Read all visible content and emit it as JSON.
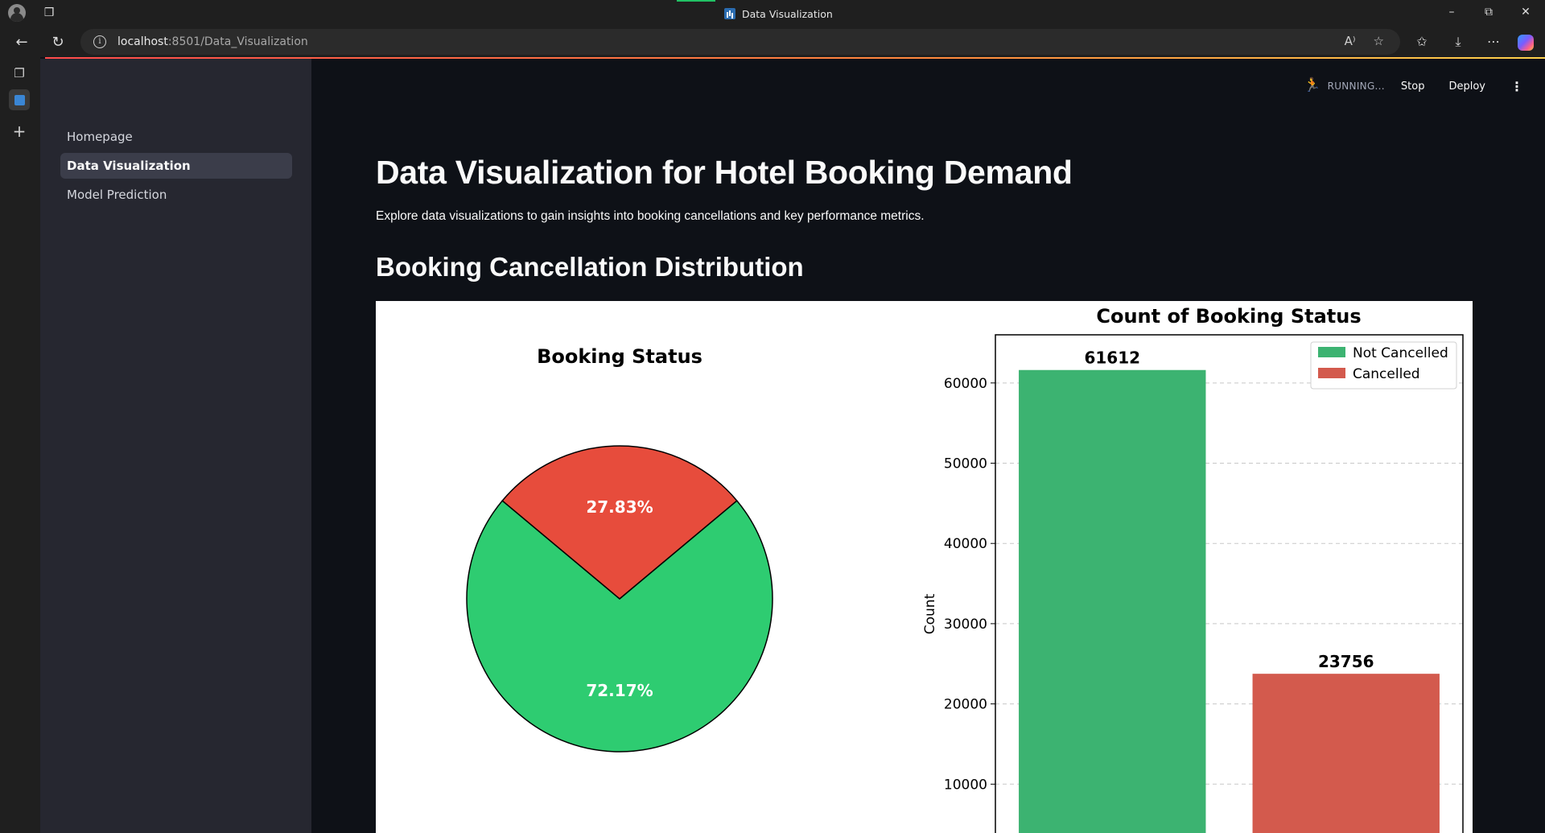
{
  "browser": {
    "tab_title": "Data Visualization",
    "url_host": "localhost",
    "url_rest": ":8501/Data_Visualization",
    "minimize": "–",
    "restore": "⧉",
    "close": "✕"
  },
  "sidebar": {
    "items": [
      {
        "label": "Homepage",
        "active": false
      },
      {
        "label": "Data Visualization",
        "active": true
      },
      {
        "label": "Model Prediction",
        "active": false
      }
    ]
  },
  "header": {
    "status": "RUNNING...",
    "stop_label": "Stop",
    "deploy_label": "Deploy",
    "menu_icon": "⋮"
  },
  "main": {
    "title": "Data Visualization for Hotel Booking Demand",
    "subtitle": "Explore data visualizations to gain insights into booking cancellations and key performance metrics.",
    "section_title": "Booking Cancellation Distribution"
  },
  "colors": {
    "not_cancelled": "#2ecc71",
    "cancelled": "#e74c3c",
    "bar_not_cancelled": "#3cb371",
    "bar_cancelled": "#d35a4d"
  },
  "chart_data": [
    {
      "type": "pie",
      "title": "Booking Status",
      "labels": [
        "Not Cancelled",
        "Cancelled"
      ],
      "values": [
        72.17,
        27.83
      ],
      "value_labels": [
        "72.17%",
        "27.83%"
      ]
    },
    {
      "type": "bar",
      "title": "Count of Booking Status",
      "categories": [
        "Not Cancelled",
        "Cancelled"
      ],
      "values": [
        61612,
        23756
      ],
      "value_labels": [
        "61612",
        "23756"
      ],
      "ylabel": "Count",
      "xlabel": "",
      "yticks": [
        "10000",
        "20000",
        "30000",
        "40000",
        "50000",
        "60000"
      ],
      "ylim": [
        0,
        66000
      ],
      "legend": [
        "Not Cancelled",
        "Cancelled"
      ],
      "legend_position": "top-right",
      "grid": "y-dashed"
    }
  ]
}
